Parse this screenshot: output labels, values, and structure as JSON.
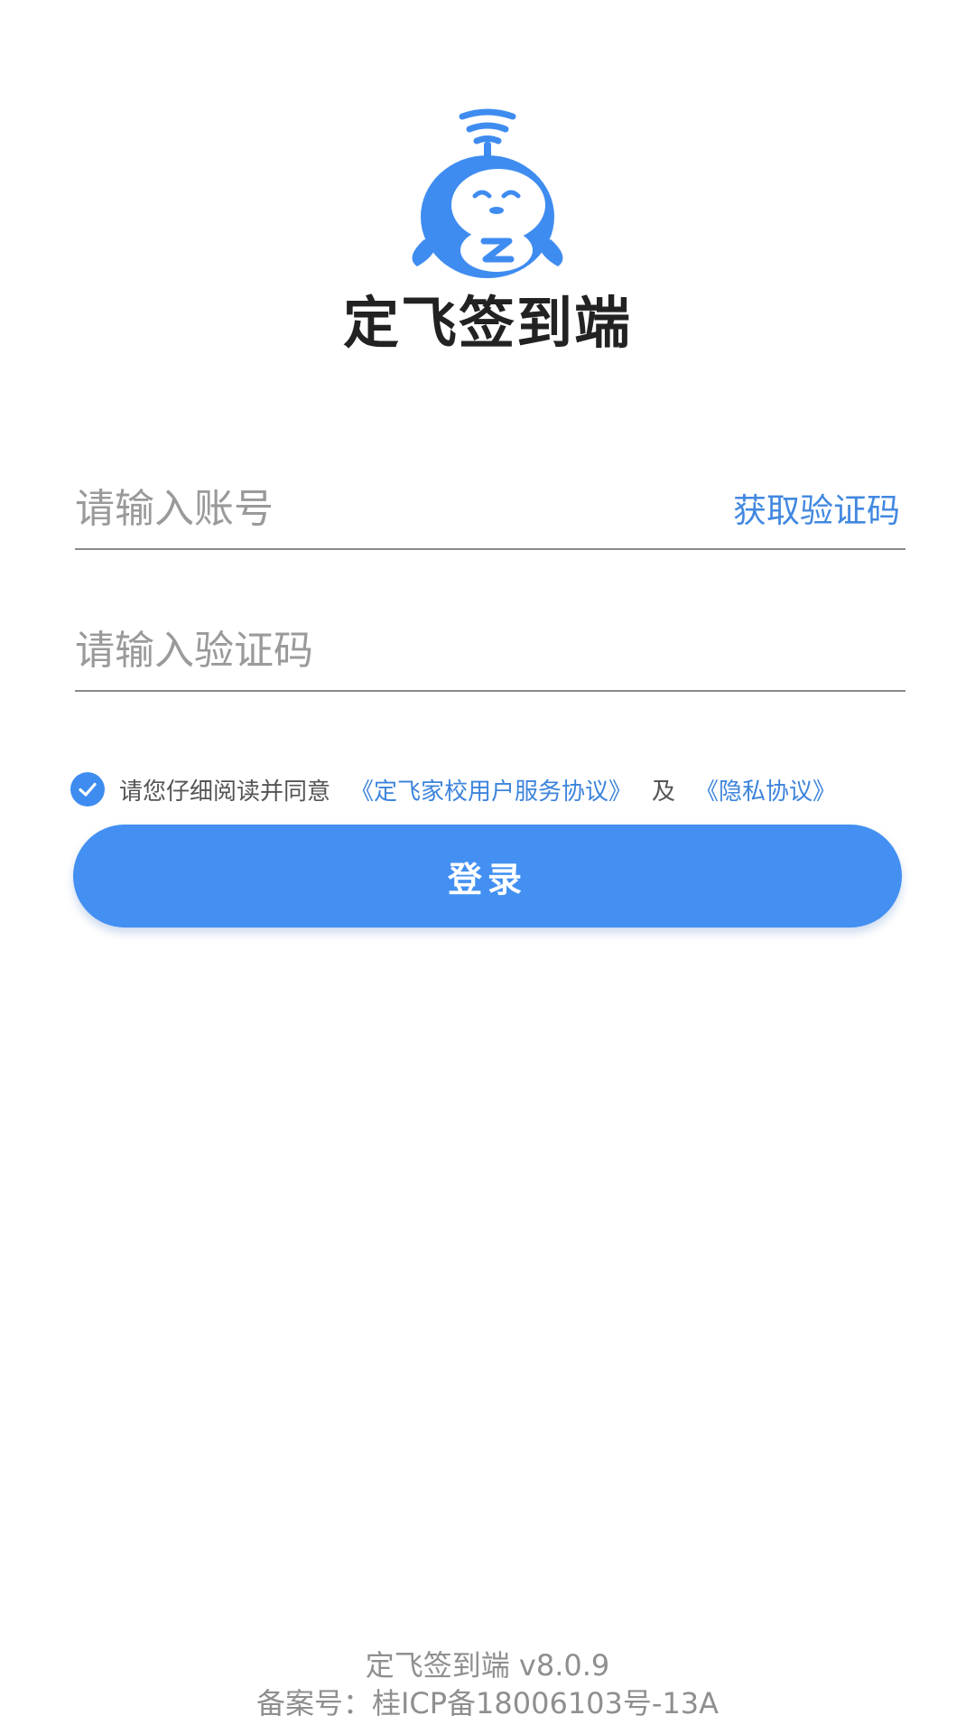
{
  "app": {
    "title": "定飞签到端",
    "brand_color": "#4390f2"
  },
  "login_form": {
    "account": {
      "placeholder": "请输入账号",
      "value": ""
    },
    "get_code_label": "获取验证码",
    "code": {
      "placeholder": "请输入验证码",
      "value": ""
    },
    "agreement": {
      "checked": true,
      "prefix": "请您仔细阅读并同意",
      "user_agreement": "《定飞家校用户服务协议》",
      "and": "及",
      "privacy_agreement": "《隐私协议》"
    },
    "login_label": "登录"
  },
  "footer": {
    "version": "定飞签到端 v8.0.9",
    "icp": "备案号：桂ICP备18006103号-13A"
  },
  "icons": {
    "logo": "monkey-mascot-icon",
    "checkbox": "check-icon"
  }
}
